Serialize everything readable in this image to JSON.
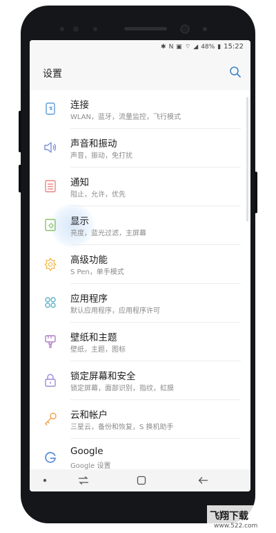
{
  "status_bar": {
    "battery": "48%",
    "time": "15:22"
  },
  "header": {
    "title": "设置"
  },
  "settings": [
    {
      "title": "连接",
      "subtitle": "WLAN，蓝牙，流量监控，飞行模式",
      "icon": "connection-icon",
      "color": "#5b9bd5"
    },
    {
      "title": "声音和振动",
      "subtitle": "声音，振动，免打扰",
      "icon": "sound-icon",
      "color": "#7a8fd6"
    },
    {
      "title": "通知",
      "subtitle": "阻止，允许，优先",
      "icon": "notification-icon",
      "color": "#e9837f"
    },
    {
      "title": "显示",
      "subtitle": "亮度，蓝光过滤，主屏幕",
      "icon": "display-icon",
      "color": "#8cc26b"
    },
    {
      "title": "高级功能",
      "subtitle": "S Pen，单手模式",
      "icon": "advanced-features-icon",
      "color": "#f2b94b"
    },
    {
      "title": "应用程序",
      "subtitle": "默认应用程序，应用程序许可",
      "icon": "apps-icon",
      "color": "#5fb3c9"
    },
    {
      "title": "壁纸和主题",
      "subtitle": "壁纸，主题，图标",
      "icon": "wallpaper-theme-icon",
      "color": "#b07cc6"
    },
    {
      "title": "锁定屏幕和安全",
      "subtitle": "锁定屏幕，面部识别，指纹，虹膜",
      "icon": "lock-icon",
      "color": "#9f8ad6"
    },
    {
      "title": "云和帐户",
      "subtitle": "三星云，备份和恢复，S 换机助手",
      "icon": "key-icon",
      "color": "#f0a04b"
    },
    {
      "title": "Google",
      "subtitle": "Google 设置",
      "icon": "google-icon",
      "color": "#5b8fd6"
    }
  ],
  "watermark": {
    "brand": "飞翔下载",
    "url": "www.522.com"
  }
}
